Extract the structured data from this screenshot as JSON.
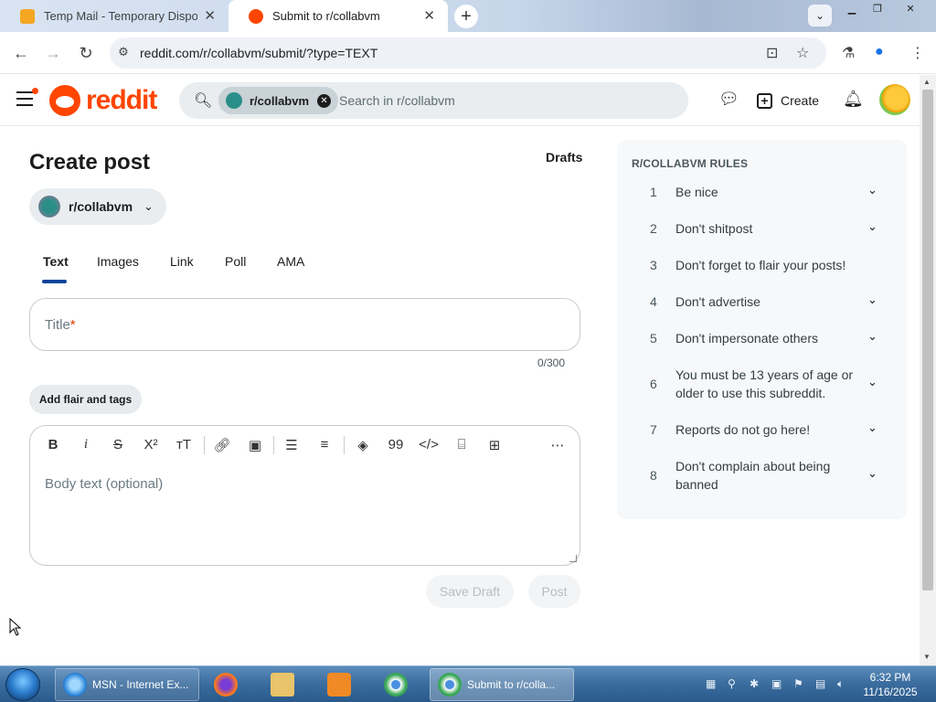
{
  "browser": {
    "tabs": [
      {
        "title": "Temp Mail - Temporary Dispos",
        "active": false,
        "favicon": "temp-mail-icon"
      },
      {
        "title": "Submit to r/collabvm",
        "active": true,
        "favicon": "reddit-icon"
      }
    ],
    "url": "reddit.com/r/collabvm/submit/?type=TEXT"
  },
  "header": {
    "logo_text": "reddit",
    "search_chip": "r/collabvm",
    "search_placeholder": "Search in r/collabvm",
    "create_label": "Create"
  },
  "main": {
    "title": "Create post",
    "drafts_label": "Drafts",
    "community": "r/collabvm",
    "tabs": [
      "Text",
      "Images",
      "Link",
      "Poll",
      "AMA"
    ],
    "active_tab": "Text",
    "title_placeholder": "Title",
    "title_required_mark": "*",
    "title_counter": "0/300",
    "flair_button": "Add flair and tags",
    "body_placeholder": "Body text (optional)",
    "toolbar_icons": [
      "bold-icon",
      "italic-icon",
      "strikethrough-icon",
      "superscript-icon",
      "heading-icon",
      "link-icon",
      "image-icon",
      "bulleted-list-icon",
      "numbered-list-icon",
      "spoiler-icon",
      "quote-icon",
      "code-icon",
      "code-block-icon",
      "table-icon",
      "more-icon"
    ],
    "save_draft_label": "Save Draft",
    "post_label": "Post"
  },
  "rules": {
    "heading": "R/COLLABVM RULES",
    "items": [
      {
        "num": "1",
        "text": "Be nice",
        "expandable": true
      },
      {
        "num": "2",
        "text": "Don't shitpost",
        "expandable": true
      },
      {
        "num": "3",
        "text": "Don't forget to flair your posts!",
        "expandable": false
      },
      {
        "num": "4",
        "text": "Don't advertise",
        "expandable": true
      },
      {
        "num": "5",
        "text": "Don't impersonate others",
        "expandable": true
      },
      {
        "num": "6",
        "text": "You must be 13 years of age or older to use this subreddit.",
        "expandable": true
      },
      {
        "num": "7",
        "text": "Reports do not go here!",
        "expandable": true
      },
      {
        "num": "8",
        "text": "Don't complain about being banned",
        "expandable": true
      }
    ]
  },
  "taskbar": {
    "items": [
      {
        "label": "MSN - Internet Ex...",
        "icon": "internet-explorer-icon"
      },
      {
        "label": "",
        "icon": "firefox-icon"
      },
      {
        "label": "",
        "icon": "file-explorer-icon"
      },
      {
        "label": "",
        "icon": "media-player-icon"
      },
      {
        "label": "",
        "icon": "chrome-icon"
      },
      {
        "label": "Submit to r/colla...",
        "icon": "chrome-icon"
      }
    ],
    "time": "6:32 PM",
    "date": "11/16/2025"
  },
  "colors": {
    "reddit_orange": "#ff4500",
    "tab_underline": "#0a449b",
    "required": "#d93a00"
  }
}
